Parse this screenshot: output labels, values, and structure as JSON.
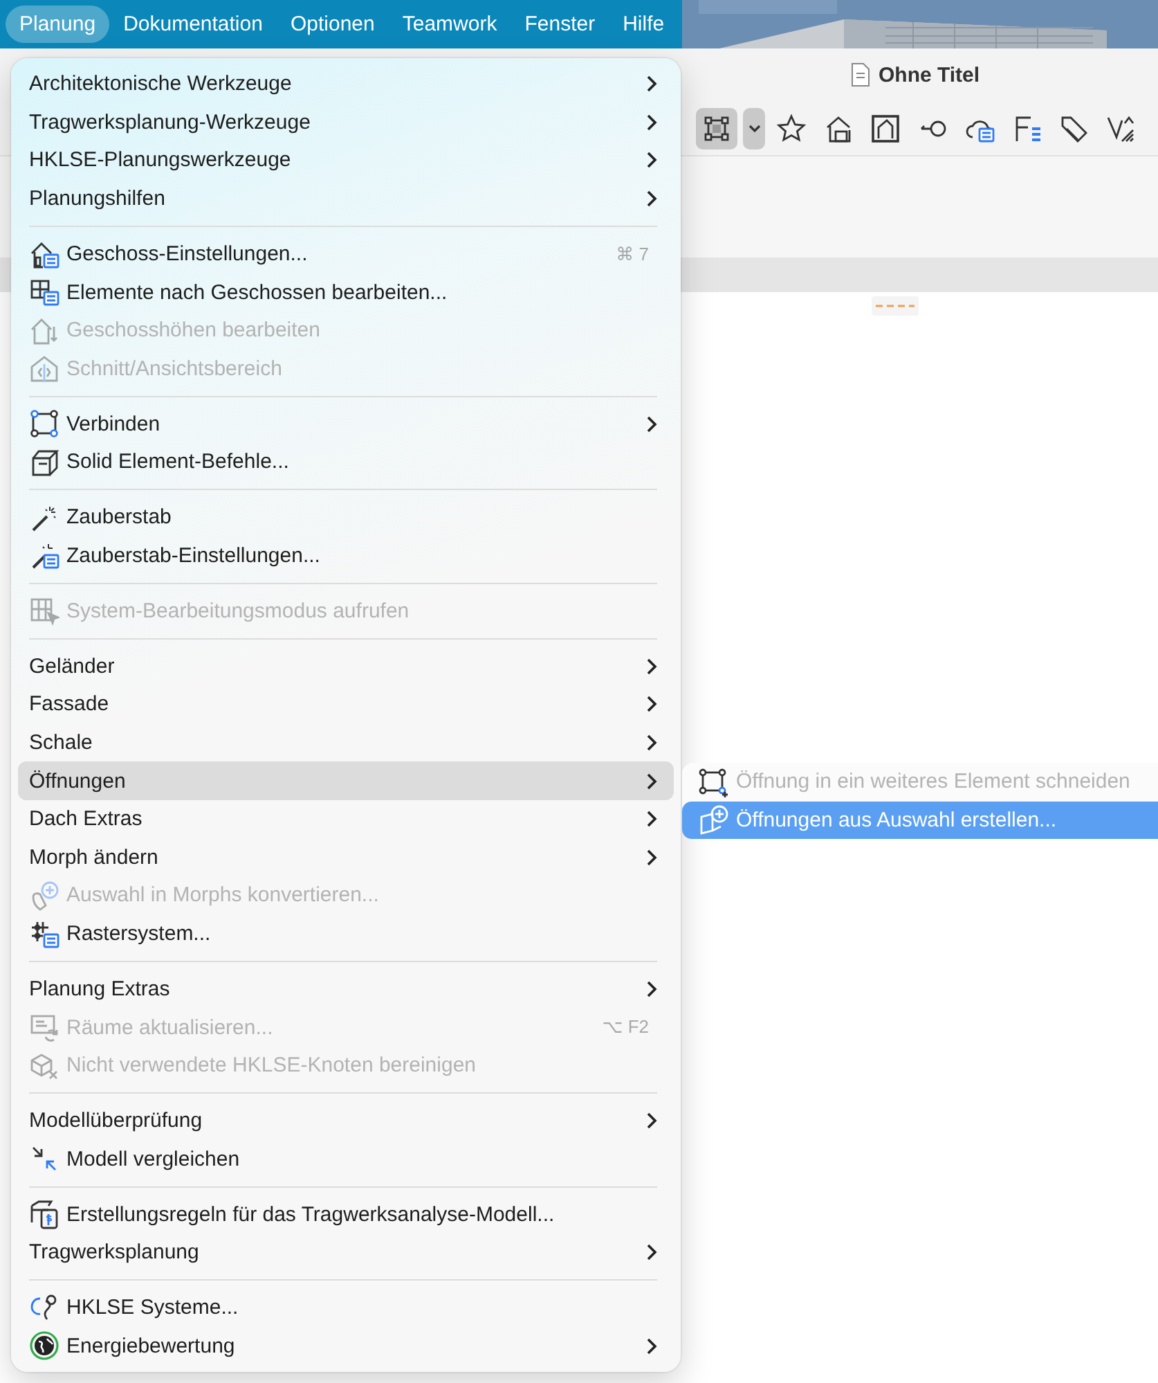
{
  "menu_bar": [
    {
      "label": "Planung",
      "selected": true
    },
    {
      "label": "Dokumentation",
      "selected": false
    },
    {
      "label": "Optionen",
      "selected": false
    },
    {
      "label": "Teamwork",
      "selected": false
    },
    {
      "label": "Fenster",
      "selected": false
    },
    {
      "label": "Hilfe",
      "selected": false
    }
  ],
  "window": {
    "title": "Ohne Titel",
    "toolbar": [
      {
        "selected": true
      },
      {
        "selected": false
      },
      {
        "selected": false
      },
      {
        "selected": false
      },
      {
        "selected": false
      },
      {
        "selected": false
      },
      {
        "selected": false
      },
      {
        "selected": false
      },
      {
        "selected": false
      }
    ]
  },
  "menu": {
    "sections": [
      {
        "items": [
          {
            "kind": "plain",
            "label": "Architektonische Werkzeuge",
            "submenu": true,
            "disabled": false,
            "selected": false
          },
          {
            "kind": "plain",
            "label": "Tragwerksplanung-Werkzeuge",
            "submenu": true,
            "disabled": false,
            "selected": false
          },
          {
            "kind": "plain",
            "label": "HKLSE-Planungswerkzeuge",
            "submenu": true,
            "disabled": false,
            "selected": false
          },
          {
            "kind": "plain",
            "label": "Planungshilfen",
            "submenu": true,
            "disabled": false,
            "selected": false
          }
        ]
      },
      {
        "items": [
          {
            "kind": "icon",
            "label": "Geschoss-Einstellungen...",
            "shortcut": "⌘ 7",
            "submenu": false,
            "disabled": false,
            "selected": false
          },
          {
            "kind": "icon",
            "label": "Elemente nach Geschossen bearbeiten...",
            "submenu": false,
            "disabled": false,
            "selected": false
          },
          {
            "kind": "icon",
            "label": "Geschosshöhen bearbeiten",
            "submenu": false,
            "disabled": true,
            "selected": false
          },
          {
            "kind": "icon",
            "label": "Schnitt/Ansichtsbereich",
            "submenu": false,
            "disabled": true,
            "selected": false
          }
        ]
      },
      {
        "items": [
          {
            "kind": "icon",
            "label": "Verbinden",
            "submenu": true,
            "disabled": false,
            "selected": false
          },
          {
            "kind": "icon",
            "label": "Solid Element-Befehle...",
            "submenu": false,
            "disabled": false,
            "selected": false
          }
        ]
      },
      {
        "items": [
          {
            "kind": "icon",
            "label": "Zauberstab",
            "submenu": false,
            "disabled": false,
            "selected": false
          },
          {
            "kind": "icon",
            "label": "Zauberstab-Einstellungen...",
            "submenu": false,
            "disabled": false,
            "selected": false
          }
        ]
      },
      {
        "items": [
          {
            "kind": "icon",
            "label": "System-Bearbeitungsmodus aufrufen",
            "submenu": false,
            "disabled": true,
            "selected": false
          }
        ]
      },
      {
        "items": [
          {
            "kind": "plain",
            "label": "Geländer",
            "submenu": true,
            "disabled": false,
            "selected": false
          },
          {
            "kind": "plain",
            "label": "Fassade",
            "submenu": true,
            "disabled": false,
            "selected": false
          },
          {
            "kind": "plain",
            "label": "Schale",
            "submenu": true,
            "disabled": false,
            "selected": false
          },
          {
            "kind": "plain",
            "label": "Öffnungen",
            "submenu": true,
            "disabled": false,
            "selected": true
          },
          {
            "kind": "plain",
            "label": "Dach Extras",
            "submenu": true,
            "disabled": false,
            "selected": false
          },
          {
            "kind": "plain",
            "label": "Morph ändern",
            "submenu": true,
            "disabled": false,
            "selected": false
          },
          {
            "kind": "icon",
            "label": "Auswahl in Morphs konvertieren...",
            "submenu": false,
            "disabled": true,
            "selected": false
          },
          {
            "kind": "icon",
            "label": "Rastersystem...",
            "submenu": false,
            "disabled": false,
            "selected": false
          }
        ]
      },
      {
        "items": [
          {
            "kind": "plain",
            "label": "Planung Extras",
            "submenu": true,
            "disabled": false,
            "selected": false
          },
          {
            "kind": "icon",
            "label": "Räume aktualisieren...",
            "shortcut": "⌥ F2",
            "submenu": false,
            "disabled": true,
            "selected": false
          },
          {
            "kind": "icon",
            "label": "Nicht verwendete HKLSE-Knoten bereinigen",
            "submenu": false,
            "disabled": true,
            "selected": false
          }
        ]
      },
      {
        "items": [
          {
            "kind": "plain",
            "label": "Modellüberprüfung",
            "submenu": true,
            "disabled": false,
            "selected": false
          },
          {
            "kind": "icon",
            "label": "Modell vergleichen",
            "submenu": false,
            "disabled": false,
            "selected": false
          }
        ]
      },
      {
        "items": [
          {
            "kind": "icon",
            "label": "Erstellungsregeln für das Tragwerksanalyse-Modell...",
            "submenu": false,
            "disabled": false,
            "selected": false
          },
          {
            "kind": "plain",
            "label": "Tragwerksplanung",
            "submenu": true,
            "disabled": false,
            "selected": false
          }
        ]
      },
      {
        "items": [
          {
            "kind": "icon",
            "label": "HKLSE Systeme...",
            "submenu": false,
            "disabled": false,
            "selected": false
          },
          {
            "kind": "icon",
            "label": "Energiebewertung",
            "submenu": true,
            "disabled": false,
            "selected": false
          }
        ]
      }
    ]
  },
  "submenu": {
    "items": [
      {
        "label": "Öffnung in ein weiteres Element schneiden",
        "disabled": true,
        "selected": false
      },
      {
        "label": "Öffnungen aus Auswahl erstellen...",
        "disabled": false,
        "selected": true
      }
    ]
  }
}
